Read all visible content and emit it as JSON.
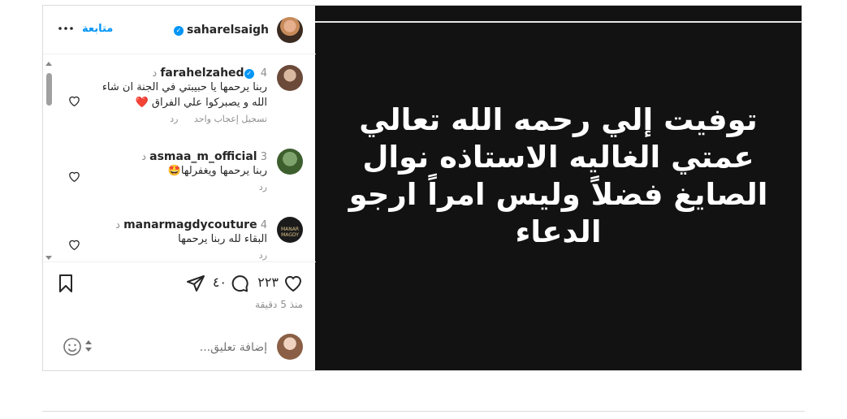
{
  "header": {
    "username": "saharelsaigh",
    "follow_label": "متابعة",
    "icons": {
      "verified": "verified-badge-icon",
      "more": "more-options-icon"
    }
  },
  "post": {
    "caption": "توفيت إلي رحمه الله تعالي عمتي الغاليه الاستاذه نوال الصايغ فضلاً وليس امراً ارجو الدعاء"
  },
  "comments": [
    {
      "username": "farahelzahed",
      "verified": true,
      "time": "4 د",
      "text": "ربنا يرحمها يا حبيبتي في الجنة ان شاء الله و يصبركوا علي الفراق ❤️",
      "like_count_label": "تسجيل إعجاب واحد",
      "reply_label": "رد"
    },
    {
      "username": "asmaa_m_official",
      "verified": false,
      "time": "3 د",
      "text": "ربنا يرحمها ويغفرلها🤩",
      "reply_label": "رد"
    },
    {
      "username": "manarmagdycouture",
      "verified": false,
      "time": "4 د",
      "text": "البقاء لله ربنا يرحمها",
      "reply_label": "رد",
      "avatar_text": "MANAR MAGDY"
    }
  ],
  "actions": {
    "likes": "٢٢٣",
    "comments": "٤٠",
    "time_ago": "منذ 5 دقيقة",
    "icons": [
      "heart-icon",
      "comment-icon",
      "share-icon",
      "save-bookmark-icon"
    ]
  },
  "add_comment": {
    "placeholder": "إضافة تعليق..."
  },
  "colors": {
    "accent": "#0095f6",
    "media_bg": "#121212",
    "heart_red": "#ed1c3d"
  }
}
